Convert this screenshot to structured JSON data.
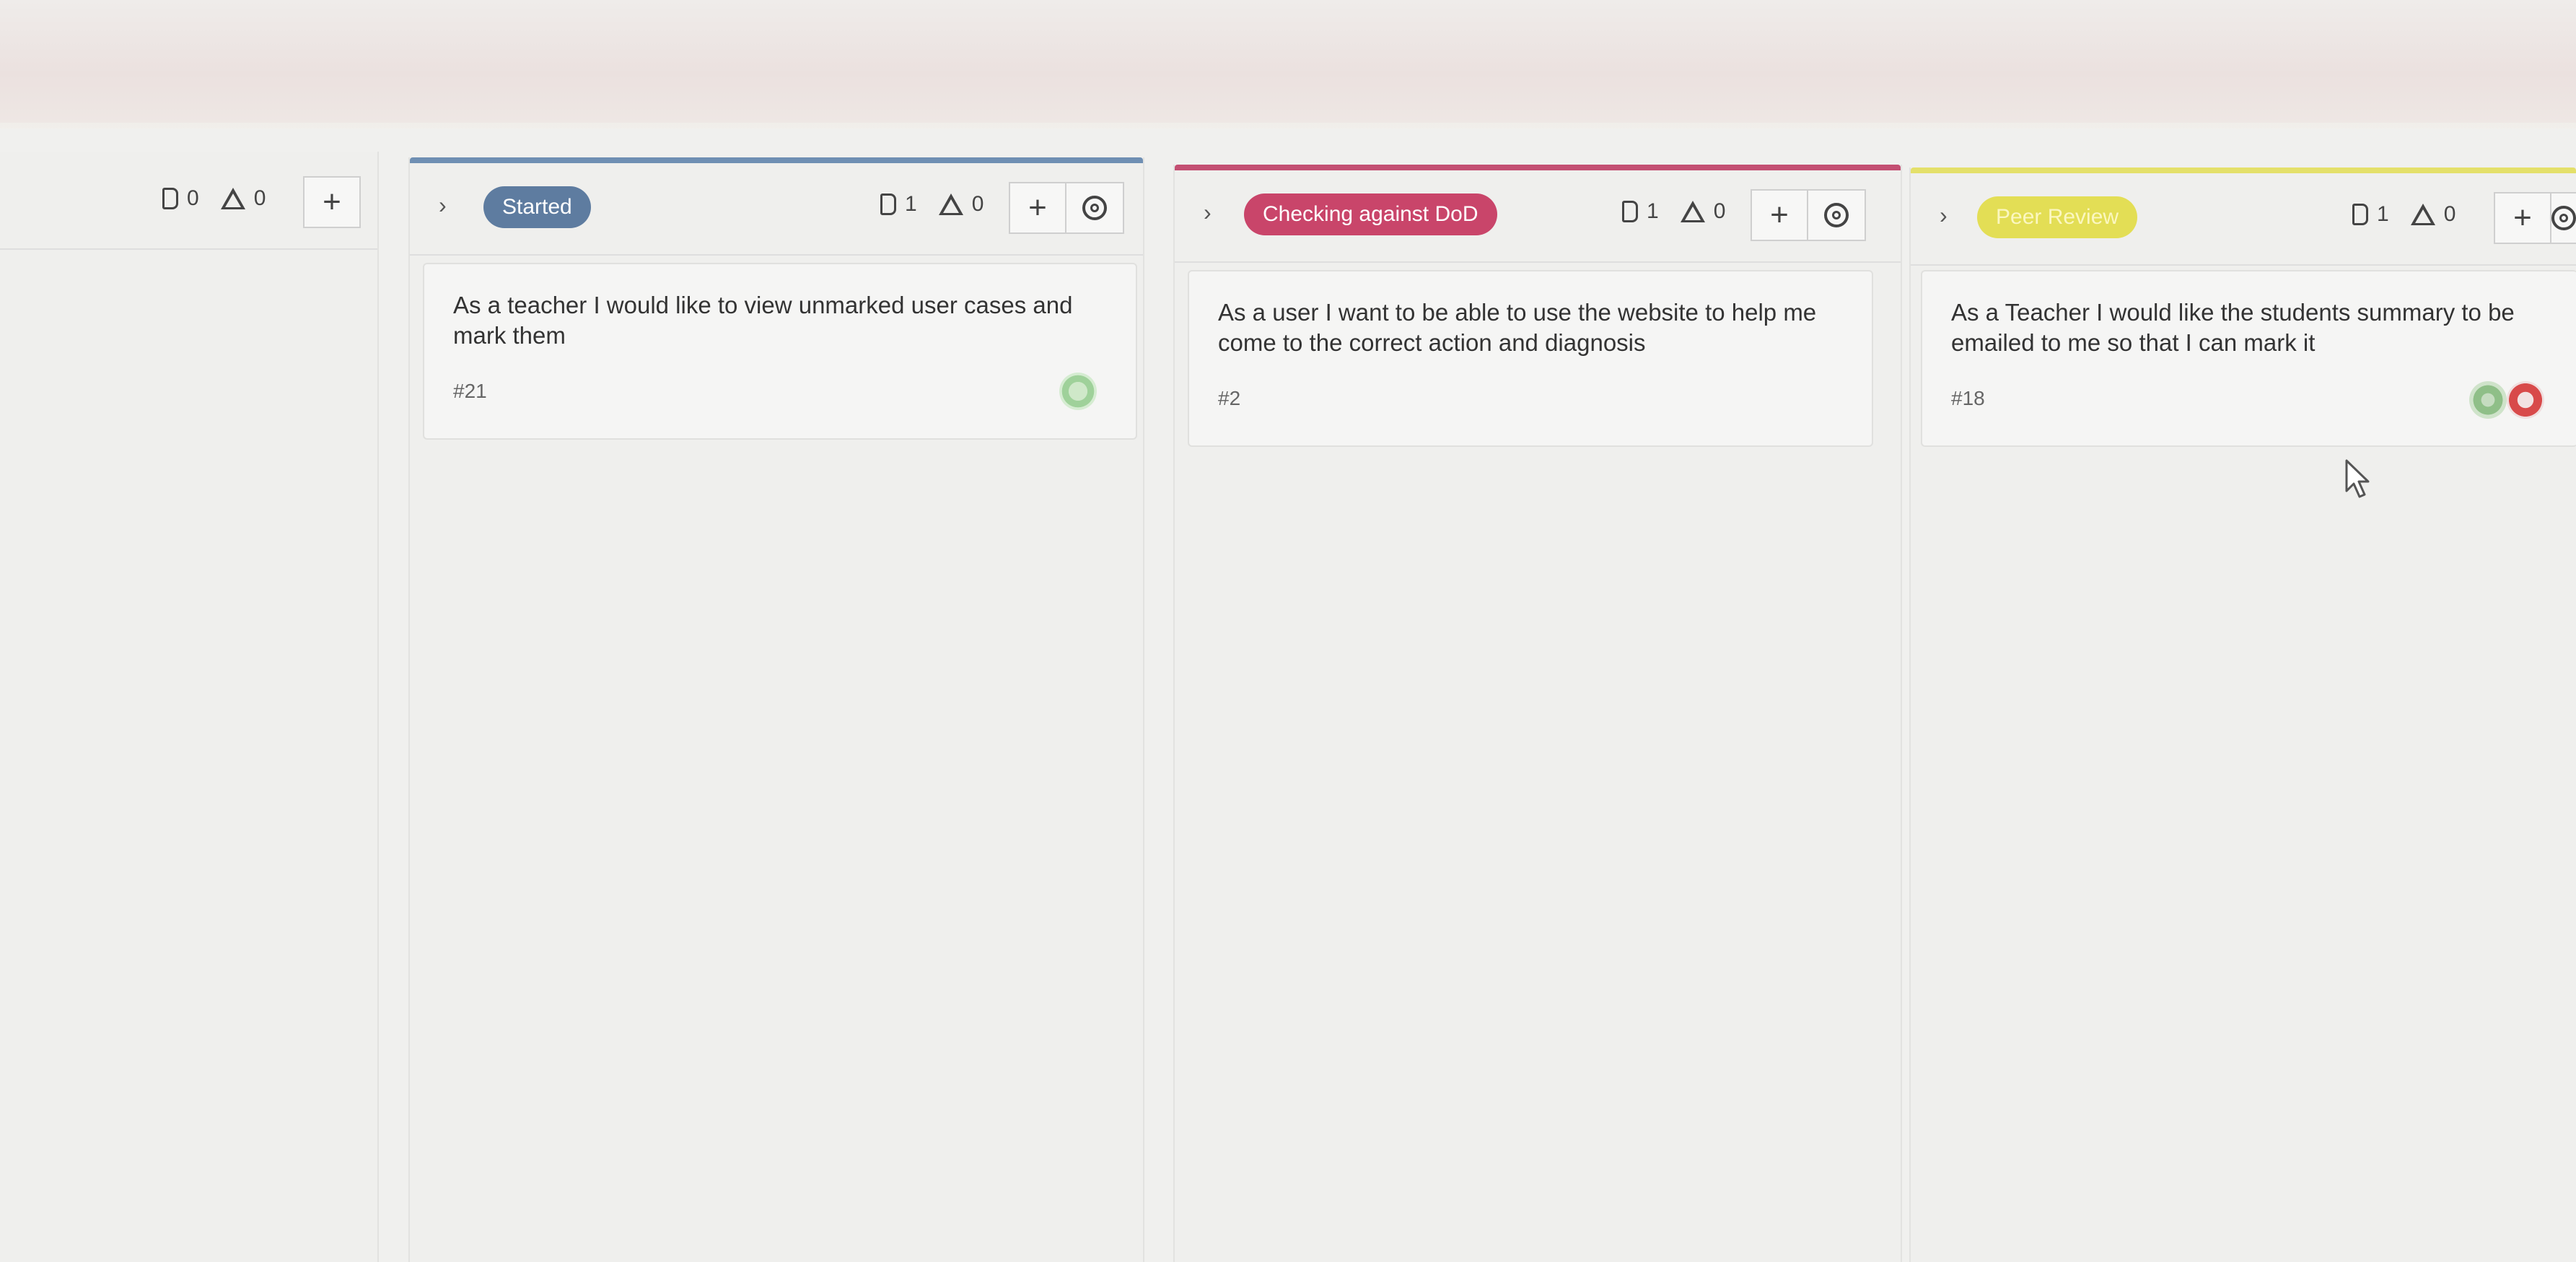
{
  "colors": {
    "started": "#5e7ca0",
    "checking": "#c9456a",
    "peer_review": "#e3de55",
    "accent_started": "#6f8fb3",
    "accent_checking": "#c34f72",
    "accent_peer": "#e4e06a"
  },
  "columns": [
    {
      "label": "",
      "issues": "0",
      "weight": "0",
      "add": "+",
      "cards": []
    },
    {
      "label": "Started",
      "issues": "1",
      "weight": "0",
      "add": "+",
      "cards": [
        {
          "title": "As a teacher I would like to view unmarked user cases and mark them",
          "id": "#21",
          "avatar": "green-avatar"
        }
      ]
    },
    {
      "label": "Checking against DoD",
      "issues": "1",
      "weight": "0",
      "add": "+",
      "cards": [
        {
          "title": "As a user I want to be able to use the website to help me come to the correct action and diagnosis",
          "id": "#2"
        }
      ]
    },
    {
      "label": "Peer Review",
      "issues": "1",
      "weight": "0",
      "add": "+",
      "cards": [
        {
          "title": "As a Teacher I would like the students summary to be emailed to me so that I can mark it",
          "id": "#18",
          "avatars": [
            "green-avatar",
            "red-avatar"
          ]
        }
      ]
    }
  ],
  "icons": {
    "chevron": "›",
    "issue": "issue-count-icon",
    "weight": "weight-icon",
    "gear": "gear-icon",
    "cursor": "mouse-cursor-icon"
  }
}
